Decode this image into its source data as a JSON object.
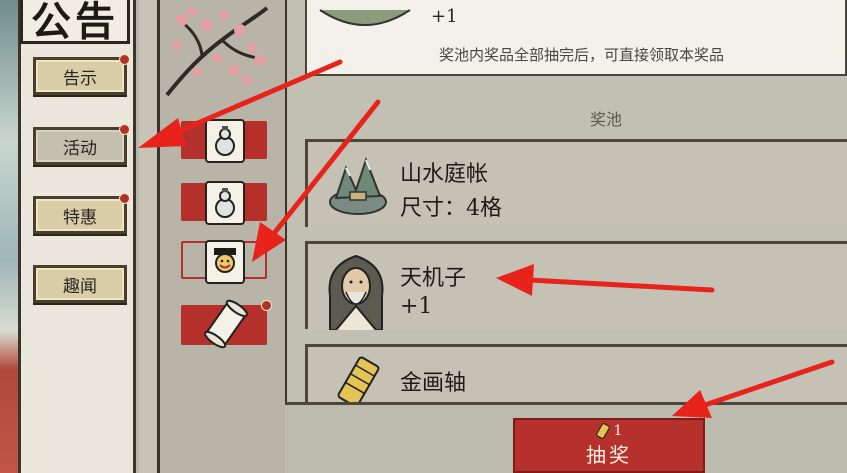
{
  "notice": {
    "title": "公告",
    "menu": [
      {
        "label": "告示",
        "has_dot": true
      },
      {
        "label": "活动",
        "has_dot": true,
        "active": true
      },
      {
        "label": "特惠",
        "has_dot": true
      },
      {
        "label": "趣闻",
        "has_dot": false
      }
    ]
  },
  "tabs": [
    {
      "icon": "gourd-bottle-icon"
    },
    {
      "icon": "gourd-bottle-icon"
    },
    {
      "icon": "character-portrait-icon",
      "selected": true
    },
    {
      "icon": "scroll-icon",
      "has_dot": true
    }
  ],
  "top_card": {
    "quantity": "+1",
    "note": "奖池内奖品全部抽完后，可直接领取本奖品"
  },
  "pool_label": "奖池",
  "prizes": [
    {
      "name": "山水庭帐",
      "detail": "尺寸：4格",
      "icon": "landscape-garden-icon"
    },
    {
      "name": "天机子",
      "detail": "+1",
      "icon": "sage-portrait-icon"
    },
    {
      "name": "金画轴",
      "detail": "",
      "icon": "golden-scroll-icon"
    }
  ],
  "draw_button": {
    "cost": "1",
    "label": "抽奖",
    "cost_icon": "scroll-ticket-icon"
  },
  "colors": {
    "accent_red": "#b7312c",
    "annotation_arrow": "#e8231c",
    "paper": "#f3f1ea"
  }
}
